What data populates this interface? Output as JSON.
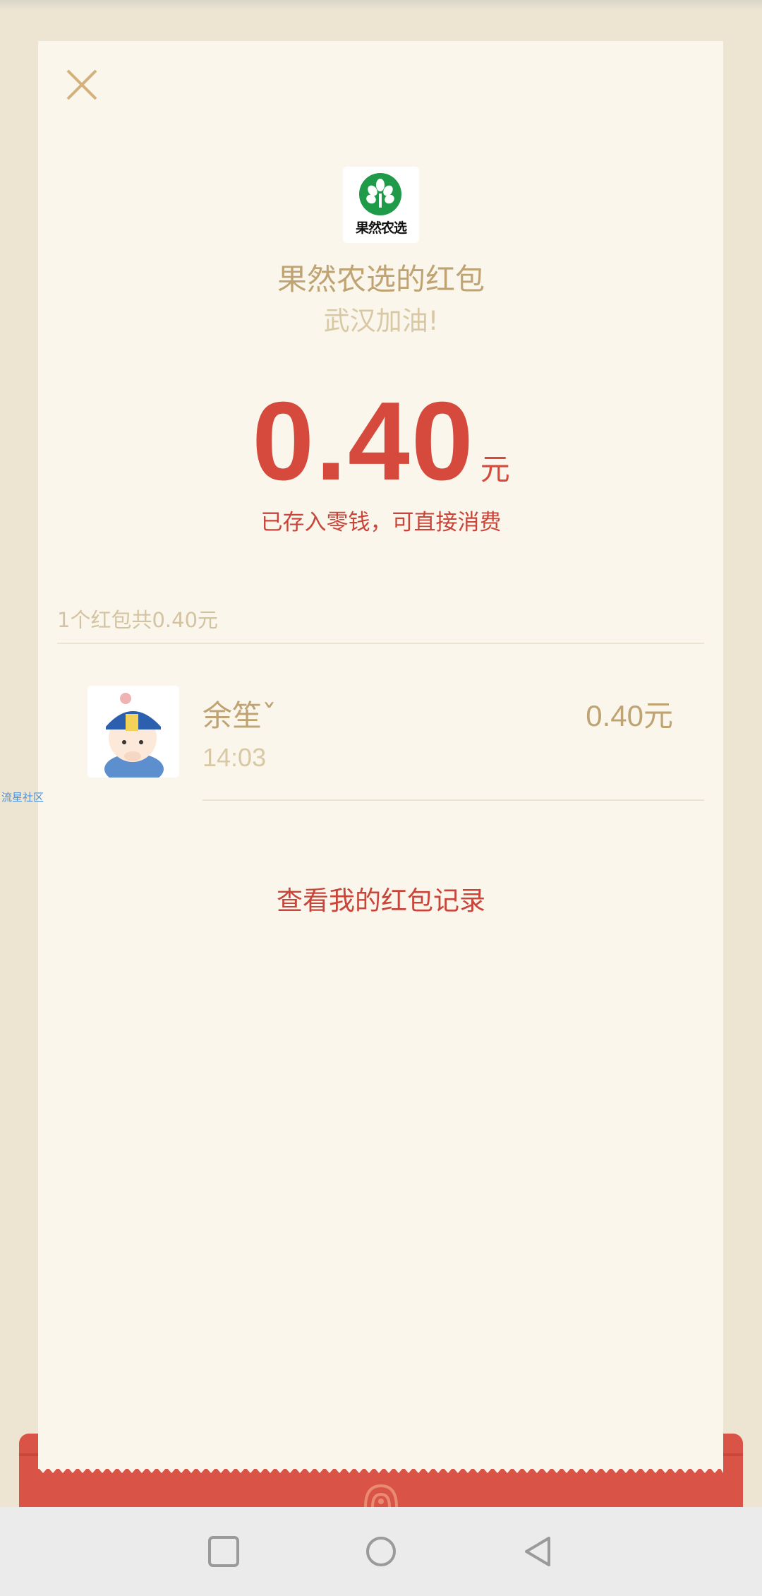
{
  "red_packet": {
    "sender_logo_text": "果然农选",
    "title": "果然农选的红包",
    "greeting": "武汉加油!",
    "amount": "0.40",
    "unit": "元",
    "stored_note": "已存入零钱，可直接消费"
  },
  "summary": "1个红包共0.40元",
  "receivers": [
    {
      "name": "余笙ˇ",
      "time": "14:03",
      "amount": "0.40元"
    }
  ],
  "watermark": "流星社区",
  "records_link": "查看我的红包记录",
  "colors": {
    "accent_red": "#d6493d",
    "gold_text": "#bfa372",
    "card_bg": "#faf6eb",
    "envelope_red": "#d95447"
  },
  "icons": {
    "close": "close-icon",
    "logo": "leaf-logo-icon",
    "emblem": "envelope-emblem-icon",
    "nav": [
      "square-recent-icon",
      "circle-home-icon",
      "triangle-back-icon"
    ]
  }
}
